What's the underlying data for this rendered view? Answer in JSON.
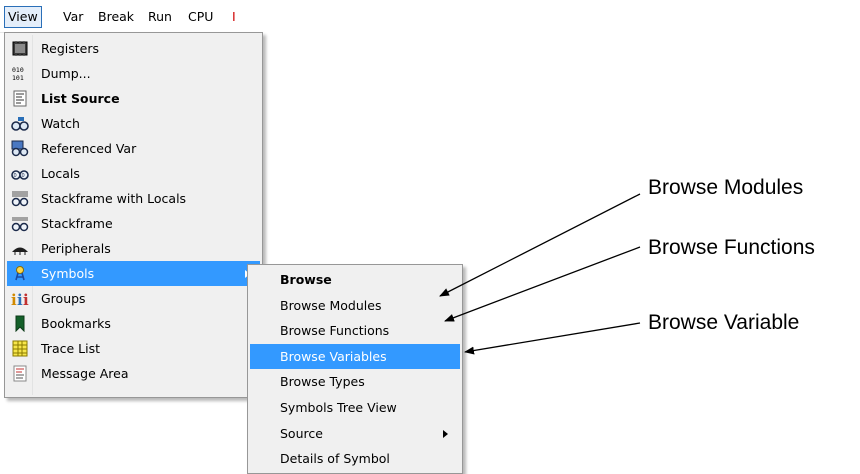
{
  "menubar": {
    "items": [
      {
        "label": "View",
        "active": true
      },
      {
        "label": "Var"
      },
      {
        "label": "Break"
      },
      {
        "label": "Run"
      },
      {
        "label": "CPU"
      }
    ],
    "trailing_fragment": "I"
  },
  "view_menu": {
    "items": [
      {
        "label": "Registers",
        "icon": "registers-icon"
      },
      {
        "label": "Dump...",
        "icon": "dump-icon"
      },
      {
        "label": "List Source",
        "icon": "list-source-icon",
        "bold": true
      },
      {
        "label": "Watch",
        "icon": "watch-icon"
      },
      {
        "label": "Referenced Var",
        "icon": "referenced-var-icon"
      },
      {
        "label": "Locals",
        "icon": "locals-icon"
      },
      {
        "label": "Stackframe with Locals",
        "icon": "stackframe-locals-icon"
      },
      {
        "label": "Stackframe",
        "icon": "stackframe-icon"
      },
      {
        "label": "Peripherals",
        "icon": "peripherals-icon"
      },
      {
        "label": "Symbols",
        "icon": "symbols-icon",
        "selected": true,
        "has_submenu": true
      },
      {
        "label": "Groups",
        "icon": "groups-icon"
      },
      {
        "label": "Bookmarks",
        "icon": "bookmark-icon"
      },
      {
        "label": "Trace List",
        "icon": "trace-list-icon"
      },
      {
        "label": "Message Area",
        "icon": "message-area-icon"
      }
    ]
  },
  "symbols_submenu": {
    "items": [
      {
        "label": "Browse",
        "bold": true
      },
      {
        "label": "Browse Modules"
      },
      {
        "label": "Browse Functions"
      },
      {
        "label": "Browse Variables",
        "selected": true
      },
      {
        "label": "Browse Types"
      },
      {
        "label": "Symbols Tree View"
      },
      {
        "label": "Source",
        "has_submenu": true
      },
      {
        "label": "Details of Symbol"
      }
    ]
  },
  "callouts": {
    "modules": "Browse Modules",
    "functions": "Browse Functions",
    "variable": "Browse Variable"
  },
  "colors": {
    "selection": "#3399ff",
    "menu_background": "#f0f0f0",
    "menu_border": "#979797",
    "menubar_active_border": "#2a6fb8"
  }
}
